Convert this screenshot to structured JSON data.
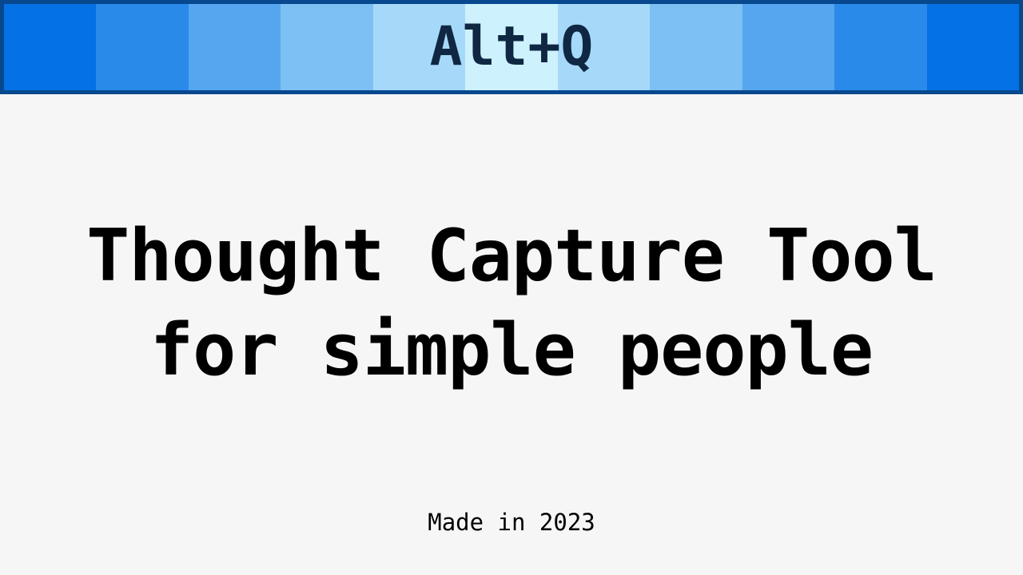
{
  "banner": {
    "title": "Alt+Q",
    "stripe_colors": [
      "#0471e4",
      "#2a8aea",
      "#55a6ef",
      "#7cc0f4",
      "#a6d9f9",
      "#cdf1fd",
      "#a6d9f9",
      "#7cc0f4",
      "#55a6ef",
      "#2a8aea",
      "#0471e4"
    ],
    "border_color": "#07488e",
    "text_color": "#0f2742"
  },
  "headline": {
    "line1": "Thought Capture Tool",
    "line2": "for simple people"
  },
  "footer": {
    "text": "Made in 2023"
  },
  "background_color": "#f6f6f6"
}
